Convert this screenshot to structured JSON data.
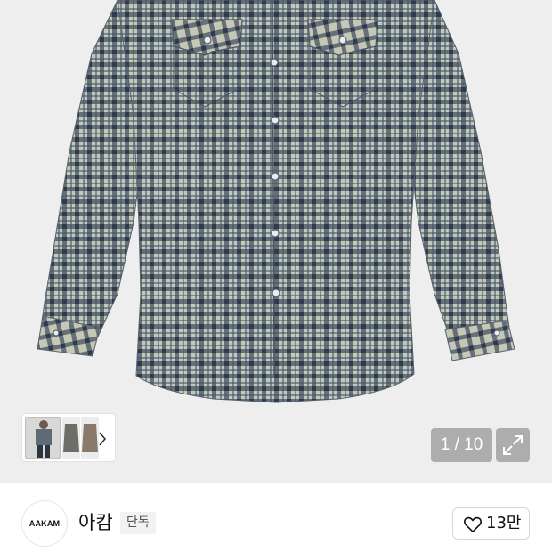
{
  "gallery": {
    "page_counter": "1 / 10",
    "icons": {
      "next": "chevron-right-icon",
      "expand": "expand-arrows-icon"
    }
  },
  "brand": {
    "logo_text": "AAKAM",
    "name": "아캄",
    "badge": "단독"
  },
  "like": {
    "count": "13만",
    "icon": "heart-outline-icon"
  },
  "colors": {
    "gallery_bg": "#eeeeef",
    "plaid_dark": "#3d4a5a",
    "plaid_light": "#c9c9b4",
    "overlay": "rgba(120,120,120,0.55)"
  }
}
